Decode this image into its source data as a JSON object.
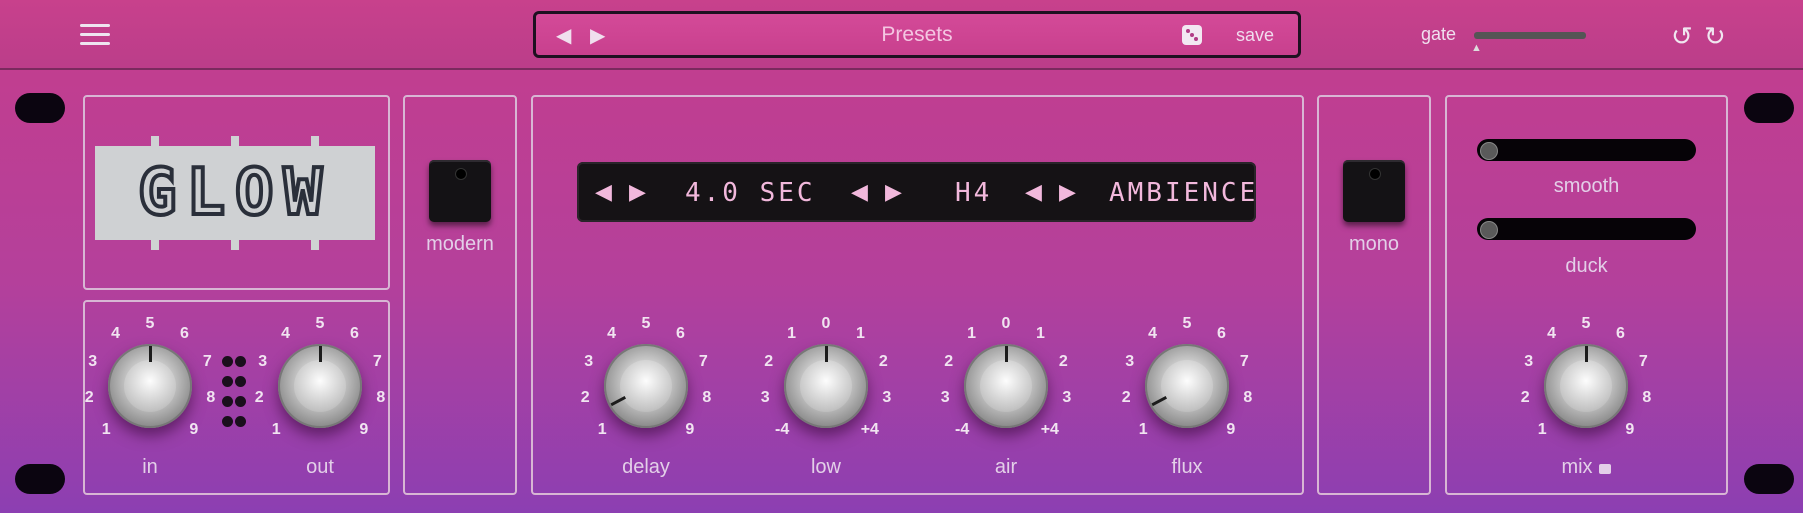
{
  "header": {
    "preset_name": "Presets",
    "save_label": "save",
    "gate_label": "gate",
    "gate_value": 0
  },
  "icons": {
    "menu": "hamburger-icon",
    "prev": "triangle-left-icon",
    "next": "triangle-right-icon",
    "random": "dice-icon",
    "undo": "undo-icon",
    "redo": "redo-icon",
    "lock": "lock-icon"
  },
  "symbols": {
    "prev": "◀",
    "next": "▶",
    "undo": "↺",
    "redo": "↻",
    "thumb": "▲"
  },
  "logo": {
    "text": "GLOW"
  },
  "switches": {
    "modern_label": "modern",
    "mono_label": "mono"
  },
  "display": {
    "time": "4.0 SEC",
    "mode": "H4",
    "algorithm": "AMBIENCE"
  },
  "knobs": {
    "in": {
      "label": "in",
      "ticks": [
        "1",
        "2",
        "3",
        "4",
        "5",
        "6",
        "7",
        "8",
        "9"
      ]
    },
    "out": {
      "label": "out",
      "ticks": [
        "1",
        "2",
        "3",
        "4",
        "5",
        "6",
        "7",
        "8",
        "9"
      ]
    },
    "delay": {
      "label": "delay",
      "ticks": [
        "1",
        "2",
        "3",
        "4",
        "5",
        "6",
        "7",
        "8",
        "9"
      ]
    },
    "low": {
      "label": "low",
      "ticks": [
        "-4",
        "3",
        "2",
        "1",
        "0",
        "1",
        "2",
        "3",
        "+4"
      ]
    },
    "air": {
      "label": "air",
      "ticks": [
        "-4",
        "3",
        "2",
        "1",
        "0",
        "1",
        "2",
        "3",
        "+4"
      ]
    },
    "flux": {
      "label": "flux",
      "ticks": [
        "1",
        "2",
        "3",
        "4",
        "5",
        "6",
        "7",
        "8",
        "9"
      ]
    },
    "mix": {
      "label": "mix",
      "ticks": [
        "1",
        "2",
        "3",
        "4",
        "5",
        "6",
        "7",
        "8",
        "9"
      ]
    }
  },
  "sliders": {
    "smooth_label": "smooth",
    "duck_label": "duck"
  },
  "colors": {
    "accent": "#c53d8c",
    "display_text": "#f2b8dc",
    "panel_border": "#d8b6d4"
  }
}
